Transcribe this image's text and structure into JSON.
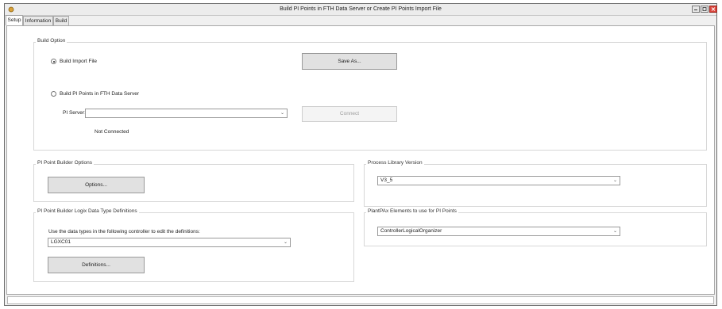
{
  "window": {
    "title": "Build PI Points in FTH Data Server or Create PI Points Import File",
    "icon": "app-icon"
  },
  "tabs": [
    {
      "label": "Setup",
      "active": true
    },
    {
      "label": "Information",
      "active": false
    },
    {
      "label": "Build",
      "active": false
    }
  ],
  "build_option": {
    "group_label": "Build Option",
    "import_radio_label": "Build Import File",
    "import_selected": true,
    "save_as_label": "Save As...",
    "server_radio_label": "Build PI Points in FTH Data Server",
    "server_selected": false,
    "pi_server_label": "PI Server:",
    "pi_server_value": "",
    "connect_label": "Connect",
    "connection_status": "Not Connected"
  },
  "builder_options": {
    "group_label": "PI Point Builder Options",
    "options_button_label": "Options..."
  },
  "process_library": {
    "group_label": "Process Library Version",
    "version_value": "V3_5"
  },
  "logix_defs": {
    "group_label": "PI Point Builder Logix Data Type Definitions",
    "instruction": "Use the data types in the following controller to edit the definitions:",
    "controller_value": "LGXC01",
    "definitions_button_label": "Definitions..."
  },
  "plantpax": {
    "group_label": "PlantPAx Elements to use for PI Points",
    "elements_value": "ControllerLogicalOrganizer"
  },
  "status_bar": {
    "text": ""
  }
}
